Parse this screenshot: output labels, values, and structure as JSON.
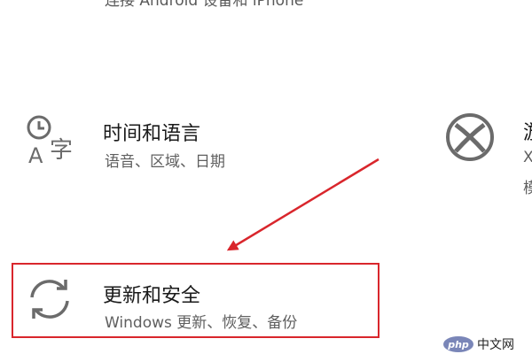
{
  "top_clipped_text": "连接 Android 设备和 iPhone",
  "tiles": {
    "time_language": {
      "title": "时间和语言",
      "subtitle": "语音、区域、日期",
      "icon": "time-language-icon"
    },
    "update_security": {
      "title": "更新和安全",
      "subtitle": "Windows 更新、恢复、备份",
      "icon": "sync-icon"
    },
    "gaming": {
      "title_partial": "游",
      "sub_partial_1": "X",
      "sub_partial_2": "模",
      "icon": "xbox-icon"
    }
  },
  "watermark": {
    "badge": "php",
    "text": "中文网"
  },
  "colors": {
    "annotation": "#d9262c",
    "icon_gray": "#6b6b6b"
  }
}
